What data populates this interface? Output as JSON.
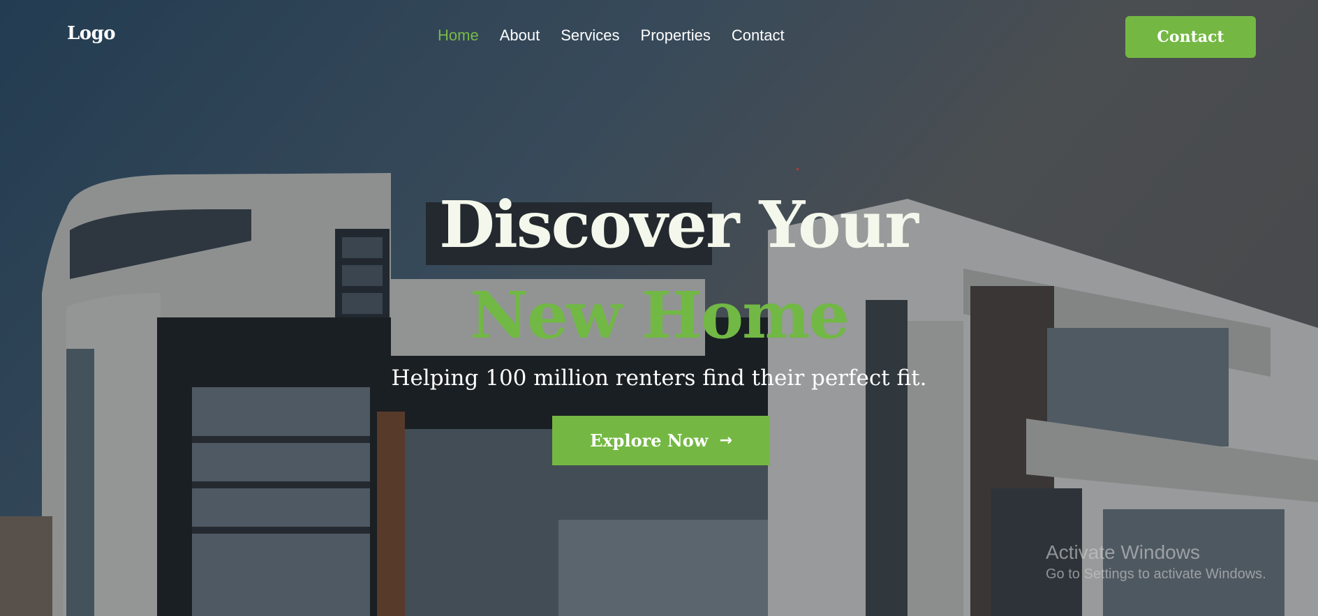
{
  "brand": {
    "logo": "Logo"
  },
  "nav": {
    "items": [
      {
        "label": "Home",
        "active": true
      },
      {
        "label": "About",
        "active": false
      },
      {
        "label": "Services",
        "active": false
      },
      {
        "label": "Properties",
        "active": false
      },
      {
        "label": "Contact",
        "active": false
      }
    ],
    "cta_label": "Contact"
  },
  "hero": {
    "headline_line1": "Discover Your",
    "headline_line2": "New Home",
    "subtitle": "Helping 100 million renters find their perfect fit.",
    "button_label": "Explore Now",
    "button_icon": "arrow-right-icon"
  },
  "watermark": {
    "title": "Activate Windows",
    "subtitle": "Go to Settings to activate Windows."
  },
  "colors": {
    "accent": "#74b843",
    "headline_light": "#f4f8ec",
    "nav_active": "#79b94a"
  }
}
